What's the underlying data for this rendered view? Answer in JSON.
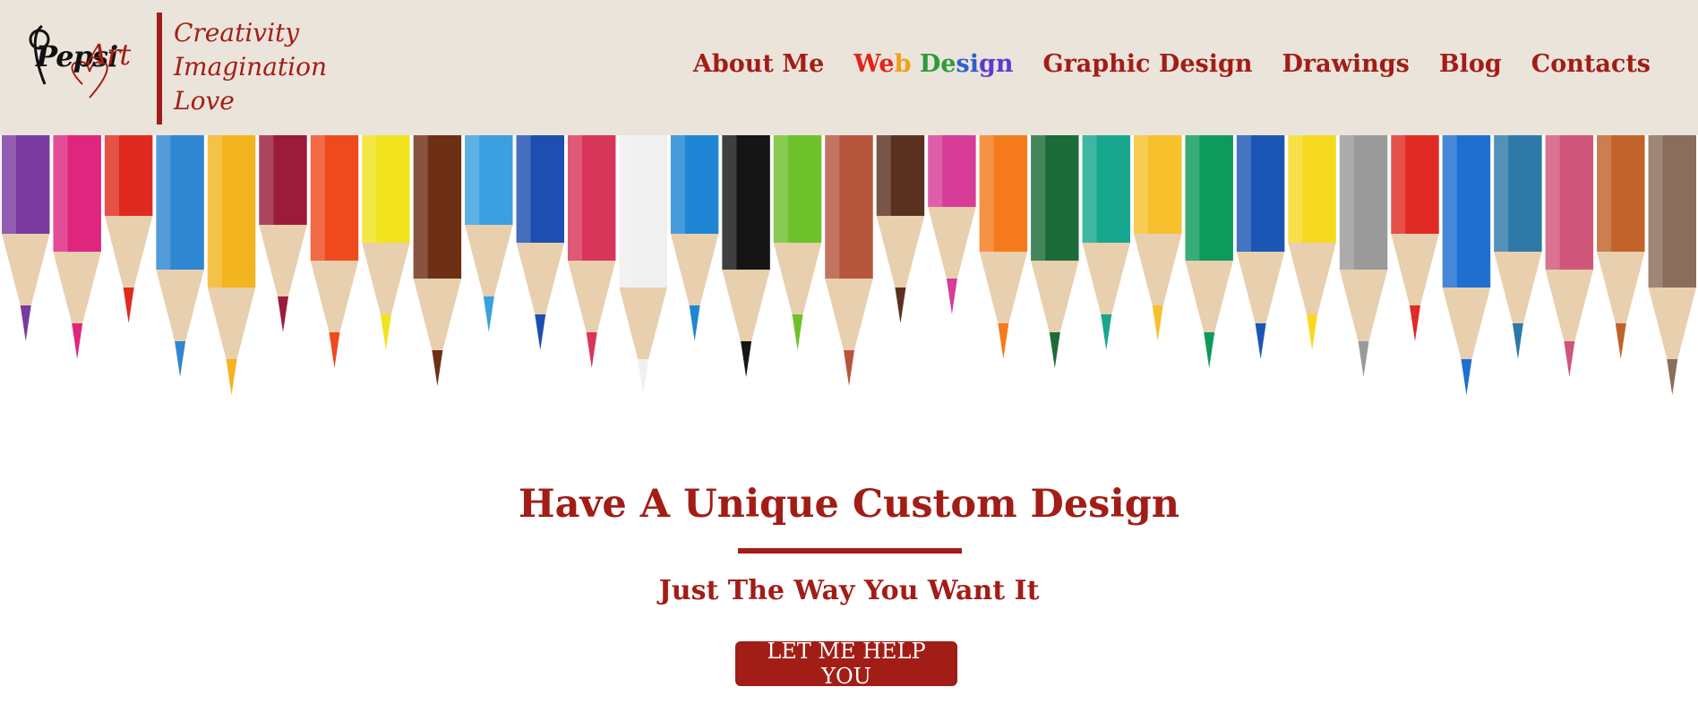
{
  "brand": {
    "name_left": "Pepsi",
    "name_right": "Art",
    "tagline": [
      "Creativity",
      "Imagination",
      "Love"
    ],
    "colors": {
      "accent": "#a21d16",
      "header_bg": "#ebe4db"
    }
  },
  "nav": {
    "items": [
      {
        "label": "About Me"
      },
      {
        "label": "Web Design",
        "active": true
      },
      {
        "label": "Graphic Design"
      },
      {
        "label": "Drawings"
      },
      {
        "label": "Blog"
      },
      {
        "label": "Contacts"
      }
    ]
  },
  "hero": {
    "title": "Have A Unique Custom Design",
    "subtitle": "Just The Way You Want It",
    "cta_label": "LET ME HELP YOU"
  },
  "banner": {
    "pencil_colors": [
      "#7a3aa0",
      "#e0257f",
      "#e02a1f",
      "#2f86d1",
      "#f2b51f",
      "#9c1b3a",
      "#ef4a1e",
      "#f2e31f",
      "#6e2f17",
      "#3aa0e0",
      "#1e4fb0",
      "#d8355a",
      "#f0f0f0",
      "#1f86d6",
      "#151515",
      "#6fc12b",
      "#b5563d",
      "#5a311f",
      "#d63c98",
      "#f57a1c",
      "#1c6b38",
      "#17a78e",
      "#f7c12d",
      "#0e9a5c",
      "#1a57b5",
      "#f6da20",
      "#9a9a9a",
      "#e12a24",
      "#1f6fd0",
      "#2f79a8",
      "#d0557a",
      "#c0622a",
      "#8a6d5a"
    ]
  }
}
